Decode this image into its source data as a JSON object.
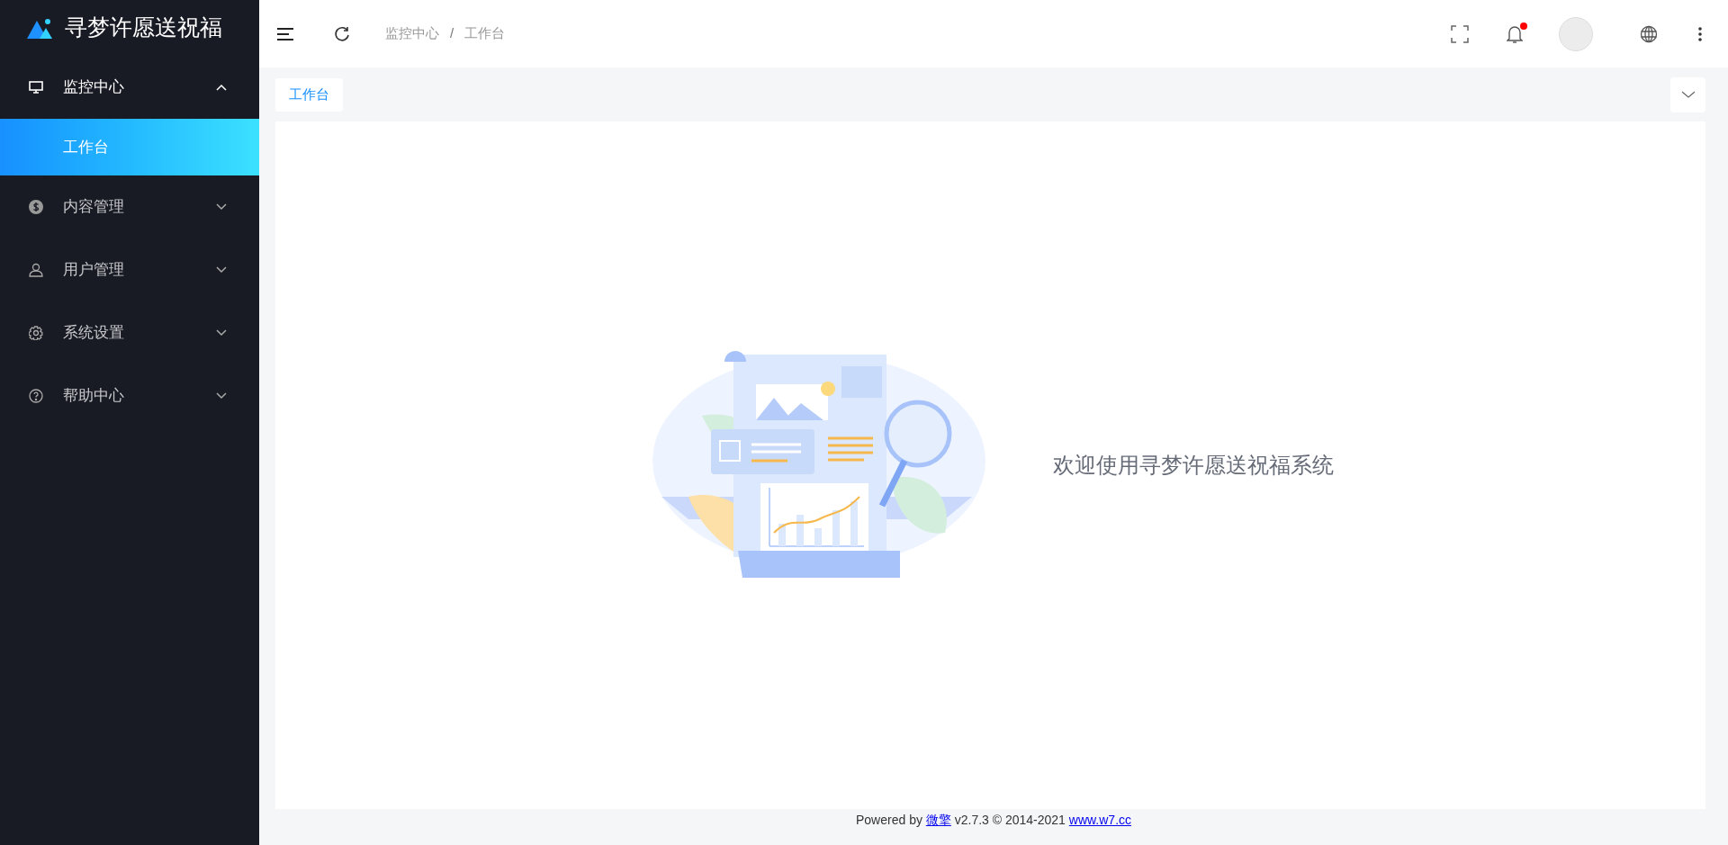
{
  "sidebar": {
    "title": "寻梦许愿送祝福",
    "menu": [
      {
        "label": "监控中心",
        "expanded": true,
        "children": [
          {
            "label": "工作台",
            "selected": true
          }
        ]
      },
      {
        "label": "内容管理",
        "expanded": false
      },
      {
        "label": "用户管理",
        "expanded": false
      },
      {
        "label": "系统设置",
        "expanded": false
      },
      {
        "label": "帮助中心",
        "expanded": false
      }
    ]
  },
  "header": {
    "breadcrumb": [
      "监控中心",
      "工作台"
    ],
    "breadcrumb_separator": "/",
    "notification_dot": true
  },
  "tabs": [
    {
      "label": "工作台",
      "selected": true
    }
  ],
  "welcome": {
    "message": "欢迎使用寻梦许愿送祝福系统"
  },
  "footer": {
    "prefix": "Powered by",
    "brand_link": "微擎",
    "version": "v2.7.3 © 2014-2021",
    "site_link": "www.w7.cc"
  }
}
